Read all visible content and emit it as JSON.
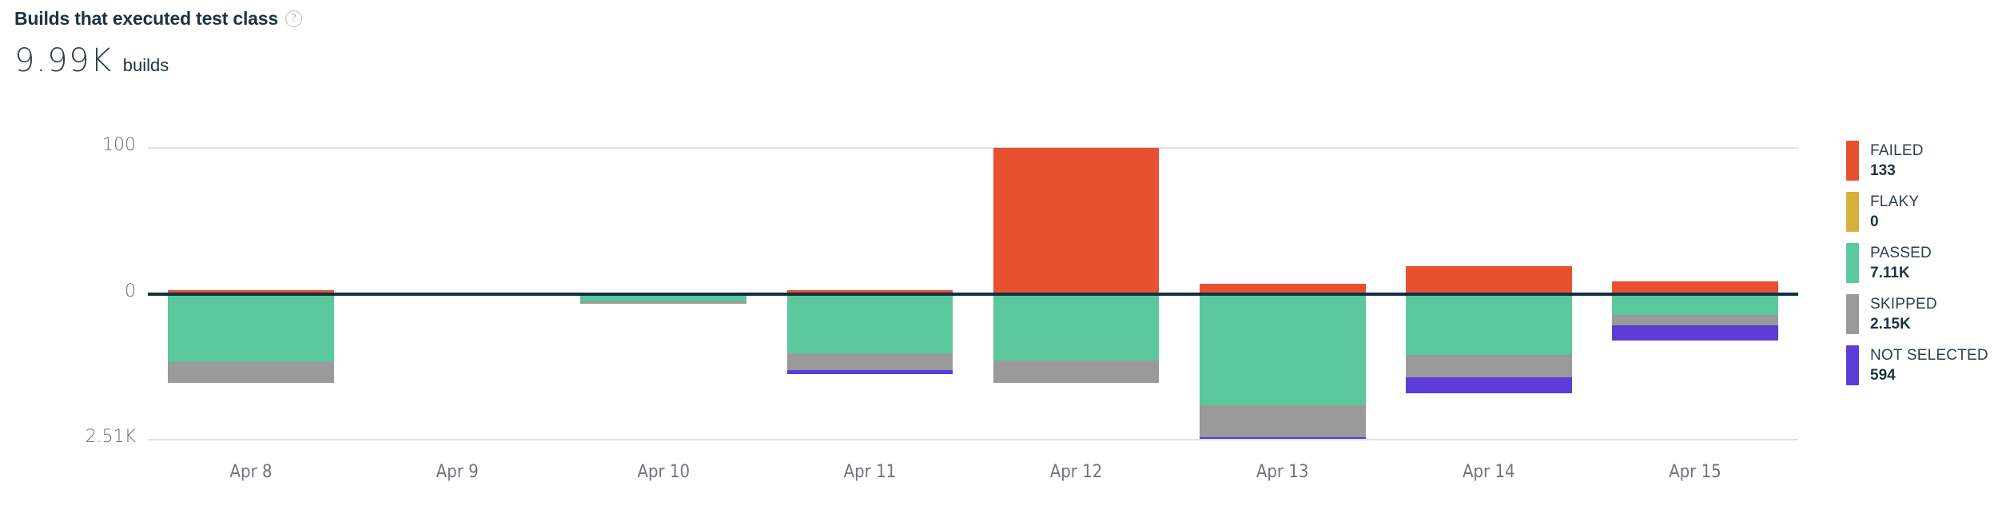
{
  "header": {
    "title": "Builds that executed test class",
    "help_icon": "help-circle-icon",
    "big_number": "9.99K",
    "big_number_unit": "builds"
  },
  "colors": {
    "failed": "#E8512F",
    "flaky": "#D7B03C",
    "passed": "#5BC79D",
    "skipped": "#9A9A9A",
    "not_selected": "#5B3CD7",
    "axis": "#12303f",
    "grid": "#dfe1e3",
    "text": "#2a4050"
  },
  "legend": {
    "items": [
      {
        "label": "FAILED",
        "value": "133",
        "color": "#E8512F",
        "key": "failed"
      },
      {
        "label": "FLAKY",
        "value": "0",
        "color": "#D7B03C",
        "key": "flaky"
      },
      {
        "label": "PASSED",
        "value": "7.11K",
        "color": "#5BC79D",
        "key": "passed"
      },
      {
        "label": "SKIPPED",
        "value": "2.15K",
        "color": "#9A9A9A",
        "key": "skipped"
      },
      {
        "label": "NOT SELECTED",
        "value": "594",
        "color": "#5B3CD7",
        "key": "not_selected"
      }
    ]
  },
  "chart_data": {
    "type": "bar",
    "subtype": "stacked-diverging",
    "title": "Builds that executed test class",
    "xlabel": "",
    "ylabel": "",
    "grid": true,
    "legend_position": "right",
    "y_ticks": [
      {
        "label": "100",
        "value": 100
      },
      {
        "label": "0",
        "value": 0
      },
      {
        "label": "2.51K",
        "value": -2510
      }
    ],
    "ylim": [
      -2510,
      100
    ],
    "categories": [
      "Apr 8",
      "Apr 9",
      "Apr 10",
      "Apr 11",
      "Apr 12",
      "Apr 13",
      "Apr 14",
      "Apr 15"
    ],
    "series": [
      {
        "name": "FAILED",
        "color": "#E8512F",
        "direction": "up",
        "values": [
          3,
          0,
          0,
          3,
          100,
          7,
          19,
          9
        ]
      },
      {
        "name": "FLAKY",
        "color": "#D7B03C",
        "direction": "up",
        "values": [
          0,
          0,
          0,
          0,
          0,
          0,
          0,
          0
        ]
      },
      {
        "name": "PASSED",
        "color": "#5BC79D",
        "direction": "down",
        "values": [
          1170,
          25,
          125,
          1015,
          1150,
          1920,
          1045,
          355
        ]
      },
      {
        "name": "SKIPPED",
        "color": "#9A9A9A",
        "direction": "down",
        "values": [
          355,
          0,
          40,
          300,
          385,
          550,
          385,
          180
        ]
      },
      {
        "name": "NOT SELECTED",
        "color": "#5B3CD7",
        "direction": "down",
        "values": [
          0,
          0,
          0,
          70,
          0,
          15,
          275,
          260
        ]
      }
    ]
  }
}
